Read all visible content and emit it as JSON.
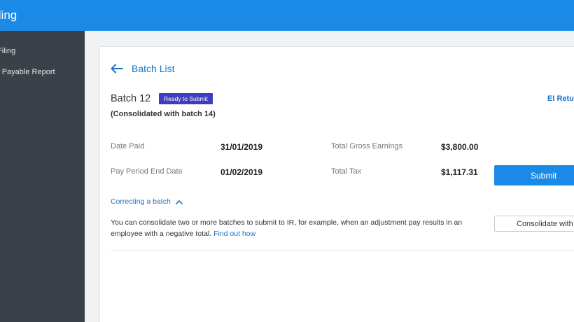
{
  "header": {
    "title": "iling"
  },
  "sidebar": {
    "items": [
      {
        "label": "Filing"
      },
      {
        "label": "r Payable Report"
      }
    ]
  },
  "main": {
    "back_label": "Batch List",
    "batch_title": "Batch 12",
    "status_badge": "Ready to Submit",
    "er_link": "EI Retur",
    "consolidated_note": "(Consolidated with batch 14)",
    "fields": {
      "date_paid_label": "Date Paid",
      "date_paid_value": "31/01/2019",
      "pay_period_end_label": "Pay Period End Date",
      "pay_period_end_value": "01/02/2019",
      "total_gross_label": "Total Gross Earnings",
      "total_gross_value": "$3,800.00",
      "total_tax_label": "Total Tax",
      "total_tax_value": "$1,117.31"
    },
    "submit_label": "Submit",
    "correcting_label": "Correcting a batch",
    "info_text": "You can consolidate two or more batches to submit to IR, for example, when an adjustment pay results in an employee with a negative total.",
    "info_link": "Find out how",
    "consolidate_label": "Consolidate with"
  },
  "colors": {
    "accent": "#1a8ae6",
    "link": "#1a73c8",
    "sidebar": "#3b4148",
    "badge": "#3d3dbe"
  },
  "icons": {
    "back": "arrow-left-icon",
    "toggle": "chevron-up-icon"
  }
}
